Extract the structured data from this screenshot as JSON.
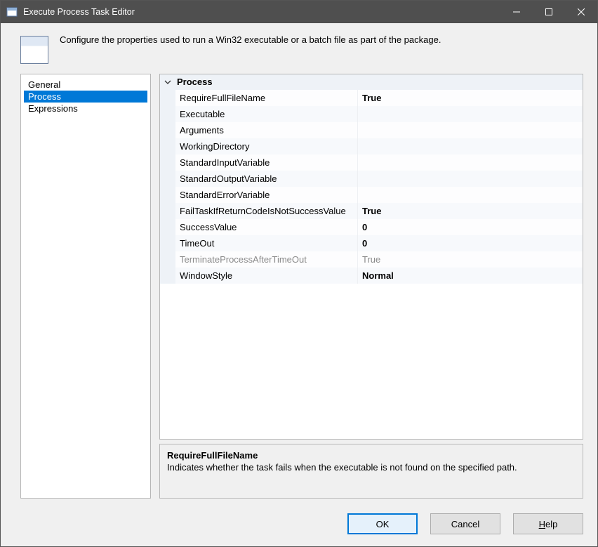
{
  "titlebar": {
    "title": "Execute Process Task Editor"
  },
  "header": {
    "description": "Configure the properties used to run a Win32 executable or a batch file as part of the package."
  },
  "sidebar": {
    "items": [
      {
        "label": "General",
        "selected": false
      },
      {
        "label": "Process",
        "selected": true
      },
      {
        "label": "Expressions",
        "selected": false
      }
    ]
  },
  "propgrid": {
    "category": "Process",
    "rows": [
      {
        "label": "RequireFullFileName",
        "value": "True",
        "disabled": false
      },
      {
        "label": "Executable",
        "value": "",
        "disabled": false
      },
      {
        "label": "Arguments",
        "value": "",
        "disabled": false
      },
      {
        "label": "WorkingDirectory",
        "value": "",
        "disabled": false
      },
      {
        "label": "StandardInputVariable",
        "value": "",
        "disabled": false
      },
      {
        "label": "StandardOutputVariable",
        "value": "",
        "disabled": false
      },
      {
        "label": "StandardErrorVariable",
        "value": "",
        "disabled": false
      },
      {
        "label": "FailTaskIfReturnCodeIsNotSuccessValue",
        "value": "True",
        "disabled": false
      },
      {
        "label": "SuccessValue",
        "value": "0",
        "disabled": false
      },
      {
        "label": "TimeOut",
        "value": "0",
        "disabled": false
      },
      {
        "label": "TerminateProcessAfterTimeOut",
        "value": "True",
        "disabled": true
      },
      {
        "label": "WindowStyle",
        "value": "Normal",
        "disabled": false
      }
    ]
  },
  "help": {
    "title": "RequireFullFileName",
    "description": "Indicates whether the task fails when the executable is not found on the specified path."
  },
  "footer": {
    "ok": "OK",
    "cancel": "Cancel",
    "help": "Help"
  }
}
